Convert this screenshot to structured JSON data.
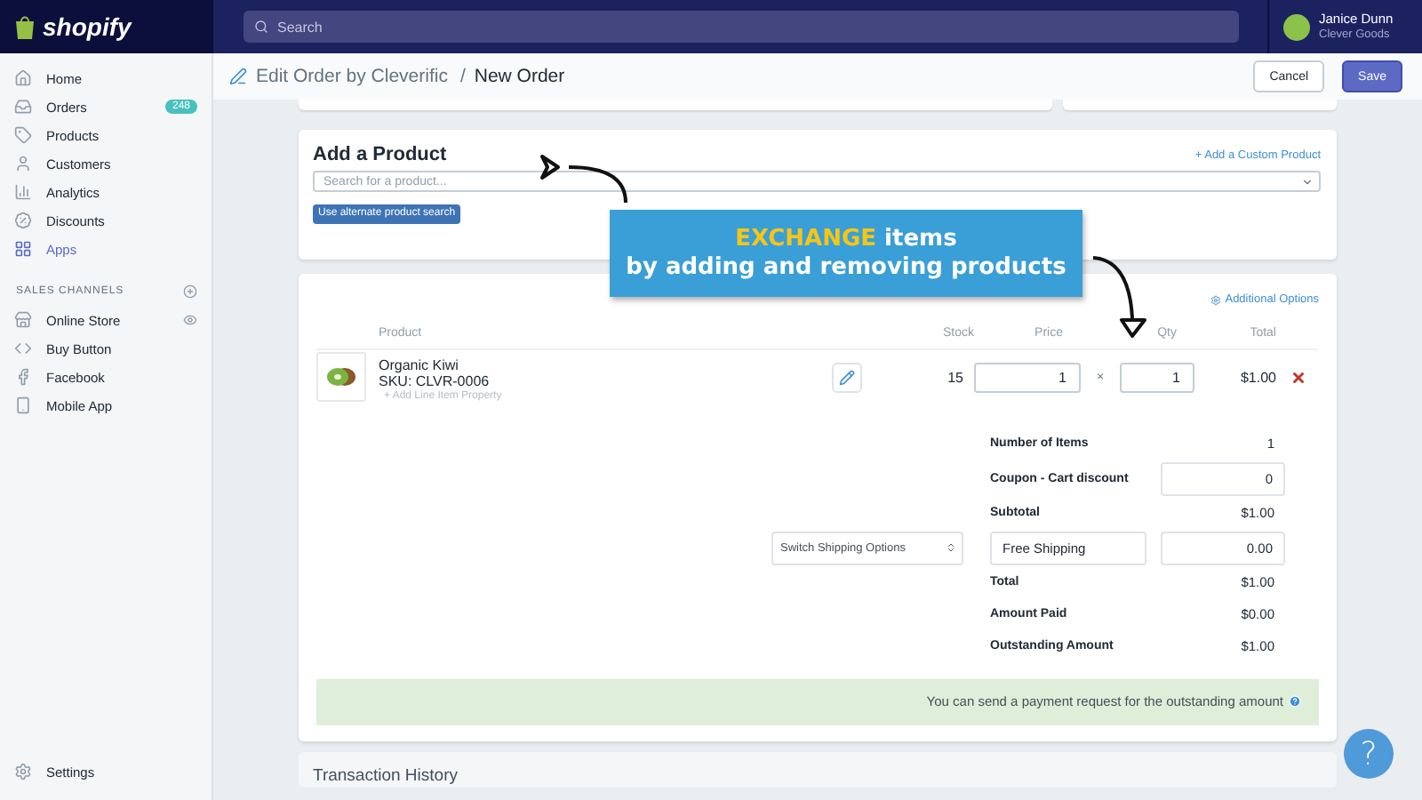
{
  "topbar": {
    "logo": "shopify",
    "search_placeholder": "Search",
    "user": {
      "name": "Janice Dunn",
      "store": "Clever Goods"
    }
  },
  "sidebar": {
    "items": [
      {
        "label": "Home",
        "selected": false
      },
      {
        "label": "Orders",
        "badge": "248",
        "selected": false
      },
      {
        "label": "Products",
        "selected": false
      },
      {
        "label": "Customers",
        "selected": false
      },
      {
        "label": "Analytics",
        "selected": false
      },
      {
        "label": "Discounts",
        "selected": false
      },
      {
        "label": "Apps",
        "selected": true
      }
    ],
    "channels_heading": "SALES CHANNELS",
    "channels": [
      {
        "label": "Online Store"
      },
      {
        "label": "Buy Button"
      },
      {
        "label": "Facebook"
      },
      {
        "label": "Mobile App"
      }
    ],
    "settings": "Settings"
  },
  "header": {
    "app": "Edit Order by Cleverific",
    "separator": "/",
    "page": "New Order",
    "buttons": [
      {
        "label": "Cancel",
        "kind": "secondary"
      },
      {
        "label": "Save",
        "kind": "primary"
      }
    ]
  },
  "add_product": {
    "title": "Add a Product",
    "link": "+ Add a Custom Product",
    "search_placeholder": "Search for a product...",
    "alt_button": "Use alternate product search"
  },
  "line_items": {
    "options_link": "Additional Options",
    "columns": [
      "Product",
      "Stock",
      "Price",
      "Qty",
      "Total"
    ],
    "rows": [
      {
        "name": "Organic Kiwi",
        "sku": "SKU: CLVR-0006",
        "property_link": "+ Add Line Item Property",
        "stock": "15",
        "price": "1",
        "times": "×",
        "qty": "1",
        "total": "$1.00"
      }
    ]
  },
  "summary": [
    {
      "kind": "text",
      "label": "Number of Items",
      "value": "1"
    },
    {
      "kind": "input",
      "label": "Coupon - Cart discount",
      "value": "0"
    },
    {
      "kind": "text",
      "label": "Subtotal",
      "value": "$1.00"
    },
    {
      "kind": "shipping",
      "select": "Switch Shipping Options",
      "label": "Free Shipping",
      "value": "0.00"
    },
    {
      "kind": "text",
      "label": "Total",
      "value": "$1.00"
    },
    {
      "kind": "text",
      "label": "Amount Paid",
      "value": "$0.00"
    },
    {
      "kind": "text",
      "label": "Outstanding Amount",
      "value": "$1.00"
    }
  ],
  "payment_notice": "You can send a payment request for the outstanding amount",
  "transaction_title": "Transaction History",
  "callout": {
    "highlight": "EXCHANGE",
    "rest": " items",
    "line2": "by adding and removing products"
  },
  "help": "?"
}
